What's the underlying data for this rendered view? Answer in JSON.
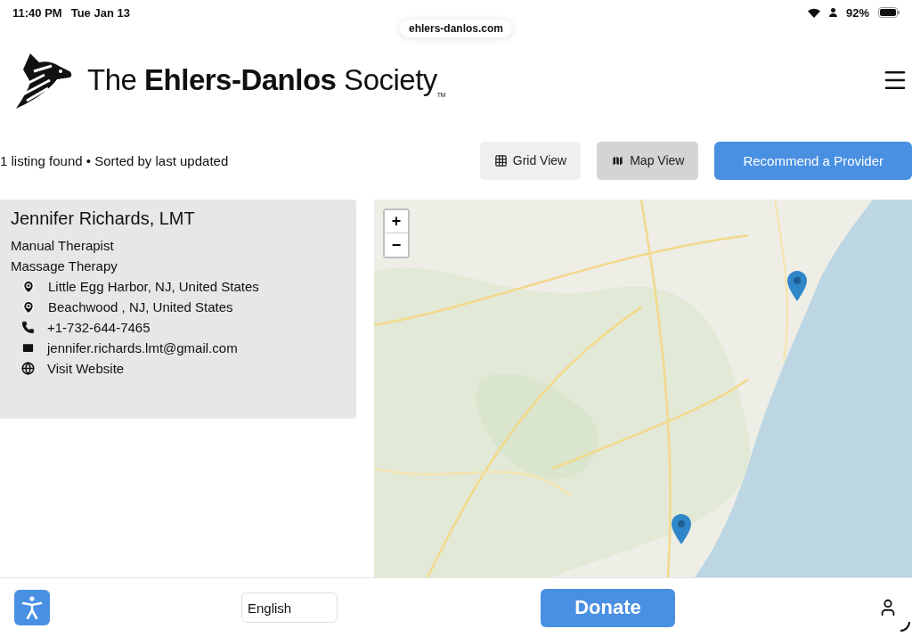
{
  "status_bar": {
    "time": "11:40 PM",
    "date": "Tue Jan 13",
    "battery": "92%"
  },
  "address_bar": {
    "url": "ehlers-danlos.com"
  },
  "header": {
    "logo_text": "The **Ehlers-Danlos** Society$_{TM}$"
  },
  "results": {
    "summary": "1 listing found • Sorted by last updated"
  },
  "view_buttons": [
    {
      "label": "Grid View",
      "kind": "grid",
      "selected": false
    },
    {
      "label": "Map View",
      "kind": "map",
      "selected": true
    }
  ],
  "recommend_button": {
    "label": "Recommend a Provider"
  },
  "listing": {
    "name": "Jennifer Richards, LMT",
    "title": "Manual Therapist",
    "specialty": "Massage Therapy",
    "details": [
      {
        "kind": "location",
        "text": "Little Egg Harbor, NJ, United States"
      },
      {
        "kind": "location",
        "text": "Beachwood , NJ, United States"
      },
      {
        "kind": "phone",
        "text": "+1-732-644-7465"
      },
      {
        "kind": "email",
        "text": "jennifer.richards.lmt@gmail.com"
      },
      {
        "kind": "website",
        "text": "Visit Website"
      }
    ]
  },
  "map": {
    "zoom_in": "+",
    "zoom_out": "−"
  },
  "footer": {
    "language": "English",
    "donate": "Donate"
  }
}
